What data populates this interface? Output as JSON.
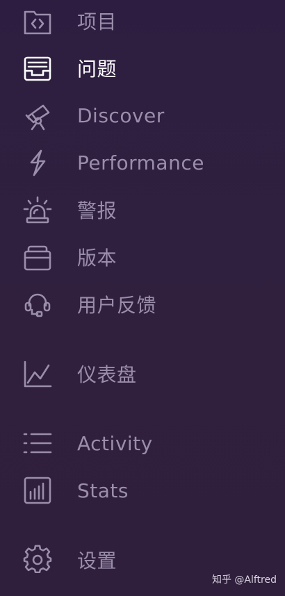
{
  "sidebar": {
    "items": [
      {
        "id": "projects",
        "label": "项目",
        "icon": "folder-code-icon",
        "active": false
      },
      {
        "id": "issues",
        "label": "问题",
        "icon": "inbox-icon",
        "active": true
      },
      {
        "id": "discover",
        "label": "Discover",
        "icon": "telescope-icon",
        "active": false
      },
      {
        "id": "performance",
        "label": "Performance",
        "icon": "lightning-icon",
        "active": false
      },
      {
        "id": "alerts",
        "label": "警报",
        "icon": "siren-icon",
        "active": false
      },
      {
        "id": "releases",
        "label": "版本",
        "icon": "releases-stack-icon",
        "active": false
      },
      {
        "id": "user-feedback",
        "label": "用户反馈",
        "icon": "headset-icon",
        "active": false
      },
      {
        "id": "dashboards",
        "label": "仪表盘",
        "icon": "line-graph-icon",
        "active": false
      },
      {
        "id": "activity",
        "label": "Activity",
        "icon": "list-icon",
        "active": false
      },
      {
        "id": "stats",
        "label": "Stats",
        "icon": "bar-chart-icon",
        "active": false
      },
      {
        "id": "settings",
        "label": "设置",
        "icon": "gear-icon",
        "active": false
      }
    ]
  },
  "watermark": "知乎 @Alftred",
  "colors": {
    "background": "#2f1f3f",
    "inactive": "#9a8eab",
    "active": "#ffffff"
  }
}
